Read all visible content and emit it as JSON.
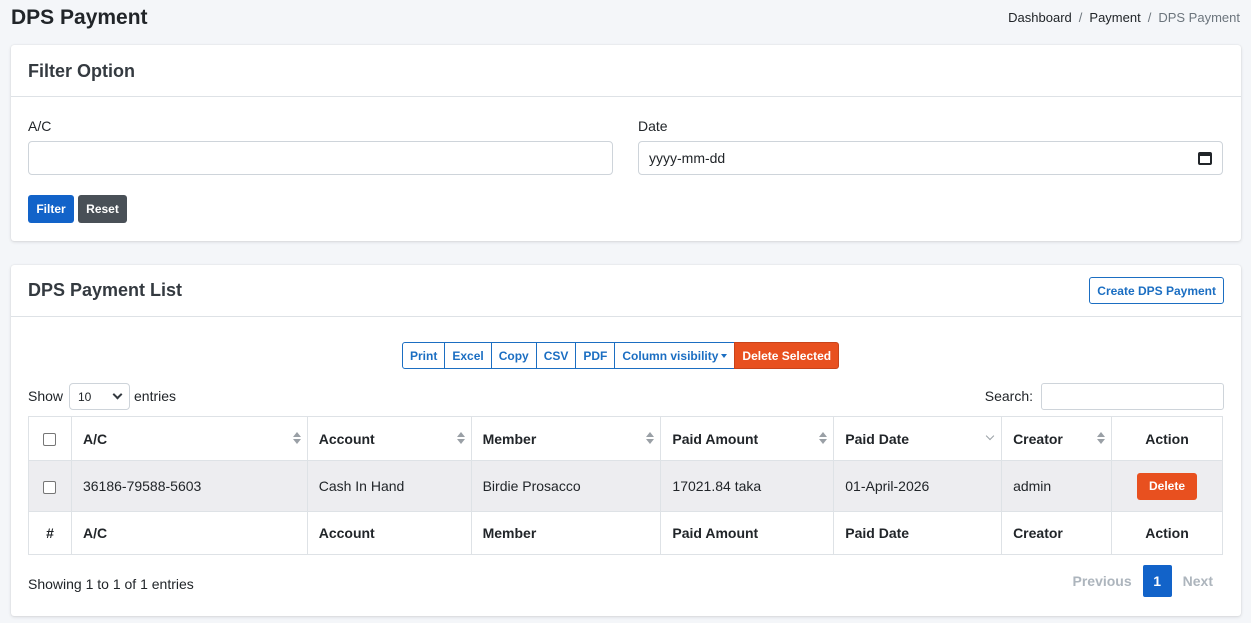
{
  "page": {
    "title": "DPS Payment",
    "breadcrumb": [
      "Dashboard",
      "Payment",
      "DPS Payment"
    ]
  },
  "filter": {
    "title": "Filter Option",
    "ac_label": "A/C",
    "ac_value": "",
    "date_label": "Date",
    "date_placeholder": "yyyy-mm-dd",
    "filter_btn": "Filter",
    "reset_btn": "Reset"
  },
  "list": {
    "title": "DPS Payment List",
    "create_btn": "Create DPS Payment",
    "export_buttons": [
      "Print",
      "Excel",
      "Copy",
      "CSV",
      "PDF",
      "Column visibility"
    ],
    "delete_selected": "Delete Selected",
    "show_label": "Show",
    "page_length": "10",
    "entries_label": "entries",
    "search_label": "Search:",
    "columns": [
      "A/C",
      "Account",
      "Member",
      "Paid Amount",
      "Paid Date",
      "Creator",
      "Action"
    ],
    "footer_first": "#",
    "rows": [
      {
        "ac": "36186-79588-5603",
        "account": "Cash In Hand",
        "member": "Birdie Prosacco",
        "paid_amount": "17021.84 taka",
        "paid_date": "01-April-2026",
        "creator": "admin",
        "action": "Delete"
      }
    ],
    "info": "Showing 1 to 1 of 1 entries",
    "pagination": {
      "previous": "Previous",
      "current": "1",
      "next": "Next"
    }
  },
  "colors": {
    "primary": "#1263c9",
    "danger": "#e8501f",
    "secondary": "#495057",
    "outline": "#1b6ec2"
  }
}
